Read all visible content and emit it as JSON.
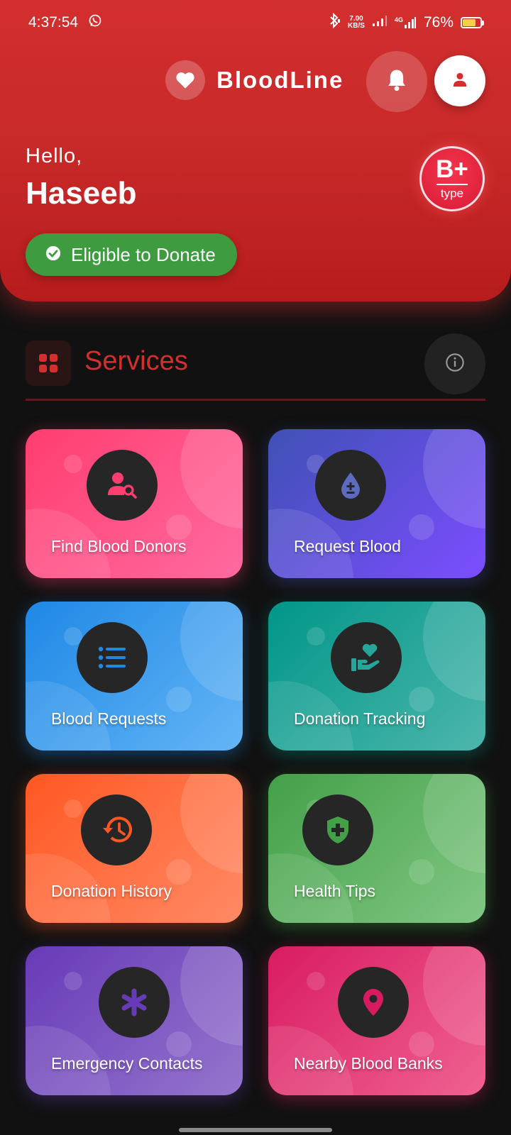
{
  "status_bar": {
    "time": "4:37:54",
    "net_speed_value": "7.00",
    "net_speed_unit": "KB/S",
    "network_label": "4G",
    "battery": "76%",
    "battery_level": 0.76
  },
  "header": {
    "app_name": "BloodLine",
    "greeting": "Hello,",
    "user_name": "Haseeb",
    "blood_type": "B+",
    "blood_type_label": "type",
    "eligibility": "Eligible to Donate"
  },
  "services": {
    "title": "Services",
    "cards": [
      {
        "label": "Find Blood Donors",
        "icon": "user-search-icon",
        "color_start": "#ff3d6f",
        "color_end": "#ff6aa0"
      },
      {
        "label": "Request Blood",
        "icon": "blood-drop-icon",
        "color_start": "#3f51b5",
        "color_end": "#7c4dff"
      },
      {
        "label": "Blood Requests",
        "icon": "list-icon",
        "color_start": "#1e88e5",
        "color_end": "#64b5f6"
      },
      {
        "label": "Donation Tracking",
        "icon": "hand-heart-icon",
        "color_start": "#009688",
        "color_end": "#4db6ac"
      },
      {
        "label": "Donation History",
        "icon": "history-icon",
        "color_start": "#ff5722",
        "color_end": "#ff8a65"
      },
      {
        "label": "Health Tips",
        "icon": "shield-plus-icon",
        "color_start": "#43a047",
        "color_end": "#81c784"
      },
      {
        "label": "Emergency Contacts",
        "icon": "asterisk-icon",
        "color_start": "#673ab7",
        "color_end": "#9575cd"
      },
      {
        "label": "Nearby Blood Banks",
        "icon": "map-pin-icon",
        "color_start": "#d81b60",
        "color_end": "#f06292"
      }
    ]
  },
  "colors": {
    "primary": "#d32f2f",
    "success": "#3e9b3f",
    "background": "#111111"
  }
}
